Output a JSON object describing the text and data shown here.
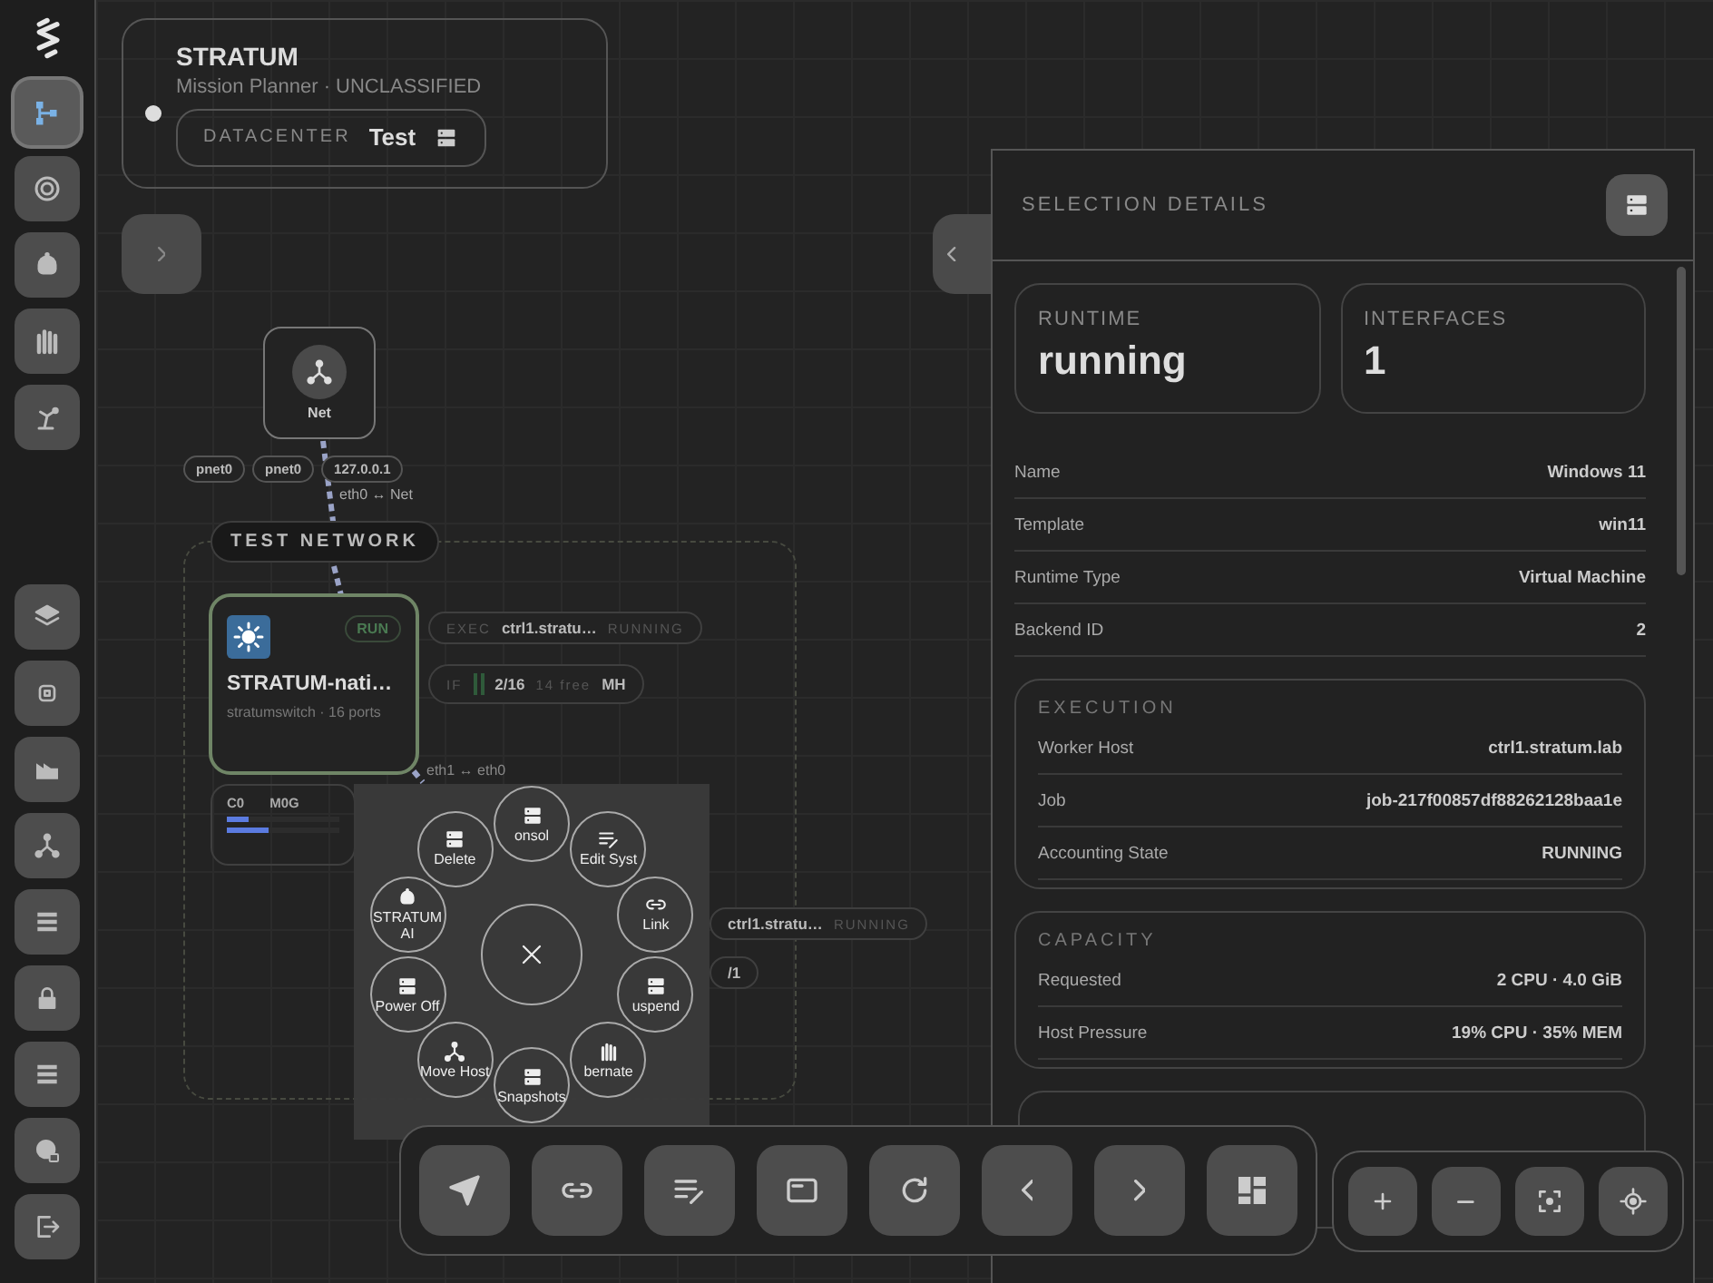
{
  "sidebar": {
    "top_items": [
      {
        "selected": true
      },
      {
        "selected": false
      },
      {
        "selected": false
      },
      {
        "selected": false
      },
      {
        "selected": false
      }
    ],
    "bottom_items": [
      {
        "selected": false
      },
      {
        "selected": false
      },
      {
        "selected": false
      },
      {
        "selected": false
      },
      {
        "selected": false
      },
      {
        "selected": false
      },
      {
        "selected": false
      },
      {
        "selected": false
      },
      {
        "selected": false
      }
    ]
  },
  "header": {
    "title": "STRATUM",
    "subtitle": "Mission Planner · UNCLASSIFIED",
    "datacenter_label": "DATACENTER",
    "datacenter_value": "Test"
  },
  "canvas": {
    "net_node": {
      "label": "Net"
    },
    "ports": [
      "pnet0",
      "pnet0",
      "127.0.0.1"
    ],
    "link_label": "eth0 ↔ Net",
    "group_label": "TEST NETWORK",
    "node": {
      "badge": "RUN",
      "name": "STRATUM-nati…",
      "subtitle": "stratumswitch · 16 ports",
      "selected": true
    },
    "exec_pill": {
      "label": "EXEC",
      "host": "ctrl1.stratu…",
      "status": "RUNNING"
    },
    "if_pill": {
      "label": "IF",
      "ports": "2/16",
      "free": "14 free",
      "tag": "MH"
    },
    "link_label_2": "eth1 ↔ eth0",
    "usage": {
      "labels": [
        "C0",
        "M0G"
      ],
      "meters": [
        {
          "level": 0.2
        },
        {
          "level": 0.37
        }
      ]
    },
    "exec_pill_2": {
      "host": "ctrl1.stratu…",
      "status": "RUNNING"
    },
    "partial_pill": "/1"
  },
  "radial_menu": {
    "items": [
      "onsol",
      "Delete",
      "Edit Syst",
      "STRATUM AI",
      "Link",
      "Power Off",
      "uspend",
      "Move Host",
      "bernate",
      "Snapshots"
    ]
  },
  "panel": {
    "title": "SELECTION DETAILS",
    "stats": [
      {
        "label": "RUNTIME",
        "value": "running"
      },
      {
        "label": "INTERFACES",
        "value": "1"
      }
    ],
    "fields": [
      {
        "label": "Name",
        "value": "Windows 11"
      },
      {
        "label": "Template",
        "value": "win11"
      },
      {
        "label": "Runtime Type",
        "value": "Virtual Machine"
      },
      {
        "label": "Backend ID",
        "value": "2"
      }
    ],
    "sections": [
      {
        "title": "EXECUTION",
        "rows": [
          {
            "label": "Worker Host",
            "value": "ctrl1.stratum.lab"
          },
          {
            "label": "Job",
            "value": "job-217f00857df88262128baa1e"
          },
          {
            "label": "Accounting State",
            "value": "RUNNING"
          }
        ]
      },
      {
        "title": "CAPACITY",
        "rows": [
          {
            "label": "Requested",
            "value": "2 CPU · 4.0 GiB"
          },
          {
            "label": "Host Pressure",
            "value": "19% CPU · 35% MEM"
          }
        ]
      }
    ]
  }
}
